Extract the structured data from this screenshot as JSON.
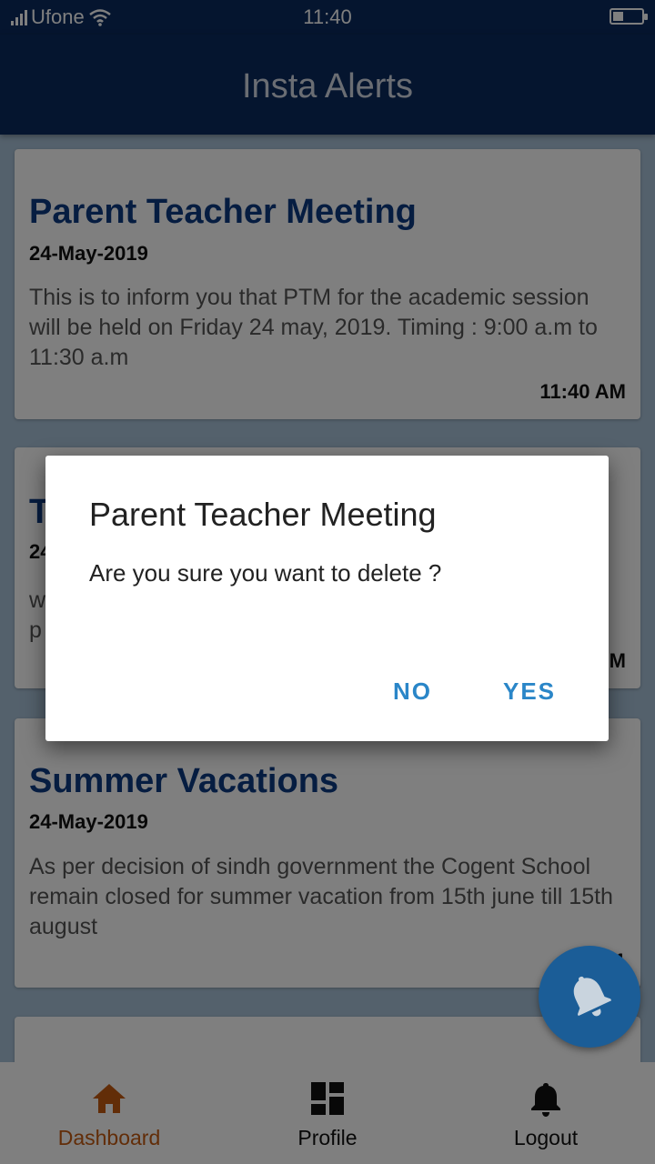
{
  "status_bar": {
    "carrier": "Ufone",
    "time": "11:40",
    "battery_level": 0.35
  },
  "app_bar": {
    "title": "Insta Alerts"
  },
  "alerts": [
    {
      "title": "Parent Teacher Meeting",
      "date": "24-May-2019",
      "message": "This is to inform you that PTM for the academic session will be held on Friday 24 may, 2019. Timing : 9:00 a.m to 11:30 a.m",
      "time": "11:40 AM"
    },
    {
      "title": "T",
      "date": "24",
      "message": "w p",
      "time": "M"
    },
    {
      "title": "Summer Vacations",
      "date": "24-May-2019",
      "message": "As per decision of sindh government the Cogent School remain closed for summer vacation from 15th june till 15th august",
      "time": "11"
    }
  ],
  "dialog": {
    "title": "Parent Teacher Meeting",
    "message": "Are you sure you want to delete ?",
    "no_label": "NO",
    "yes_label": "YES"
  },
  "bottom_nav": [
    {
      "label": "Dashboard",
      "icon": "home-icon",
      "active": true
    },
    {
      "label": "Profile",
      "icon": "dashboard-grid-icon",
      "active": false
    },
    {
      "label": "Logout",
      "icon": "bell-icon",
      "active": false
    }
  ],
  "colors": {
    "primary": "#0b2a5e",
    "card_title": "#0d3a82",
    "active_nav": "#c55a11",
    "dialog_button": "#2a86c8",
    "fab": "#1b5d97"
  }
}
